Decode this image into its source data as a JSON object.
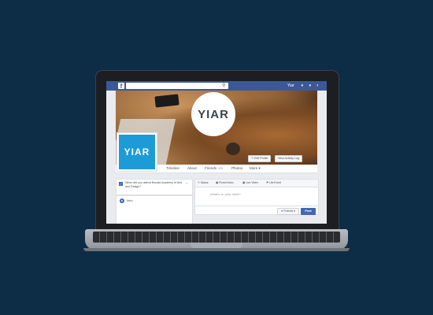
{
  "topbar": {
    "logo": "f",
    "search_placeholder": "",
    "user_name": "Yiar"
  },
  "cover": {
    "logo_text": "YIAR",
    "edit_profile_label": "Edit Profile",
    "activity_log_label": "View Activity Log"
  },
  "profile": {
    "logo_text": "YIAR"
  },
  "profile_nav": {
    "items": [
      {
        "label": "Timeline"
      },
      {
        "label": "About"
      },
      {
        "label": "Friends",
        "count": "235"
      },
      {
        "label": "Photos"
      },
      {
        "label": "More ▾"
      }
    ]
  },
  "left_column": {
    "prompt": "When did you attend Bonald Academy of Arts and Design?",
    "close": "×",
    "intro_label": "Intro"
  },
  "composer": {
    "tabs": [
      "Status",
      "Photo/Video",
      "Live Video",
      "Life Event"
    ],
    "placeholder": "What's on your mind?",
    "audience_label": "Friends ▾",
    "post_label": "Post"
  },
  "colors": {
    "fb_blue": "#3b5998",
    "button_blue": "#4267b2",
    "brand_blue": "#1d9bd7",
    "background": "#0d2d47"
  }
}
